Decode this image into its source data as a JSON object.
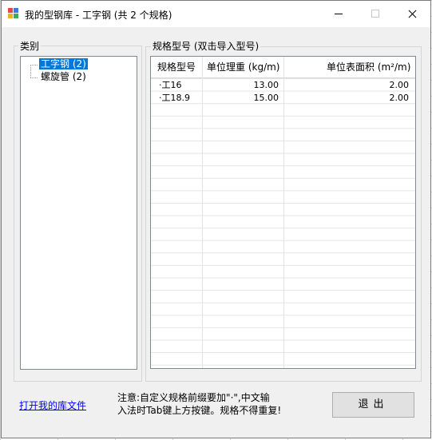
{
  "window": {
    "title": "我的型钢库 - 工字钢 (共 2 个规格)"
  },
  "category_group": {
    "label": "类别",
    "items": [
      {
        "label": "工字钢 (2)",
        "selected": true
      },
      {
        "label": "螺旋管 (2)",
        "selected": false
      }
    ]
  },
  "spec_group": {
    "label": "规格型号 (双击导入型号)",
    "columns": [
      "规格型号",
      "单位理重 (kg/m)",
      "单位表面积 (m²/m)"
    ],
    "rows": [
      {
        "name": "·工16",
        "weight": "13.00",
        "area": "2.00"
      },
      {
        "name": "·工18.9",
        "weight": "15.00",
        "area": "2.00"
      }
    ]
  },
  "footer": {
    "open_link": "打开我的库文件",
    "note_line1": "注意:自定义规格前缀要加\"·\",中文输",
    "note_line2": "入法时Tab键上方按键。规格不得重复!",
    "exit_label": "退出"
  },
  "colors": {
    "selection": "#0078d7",
    "link": "#0000ff"
  }
}
